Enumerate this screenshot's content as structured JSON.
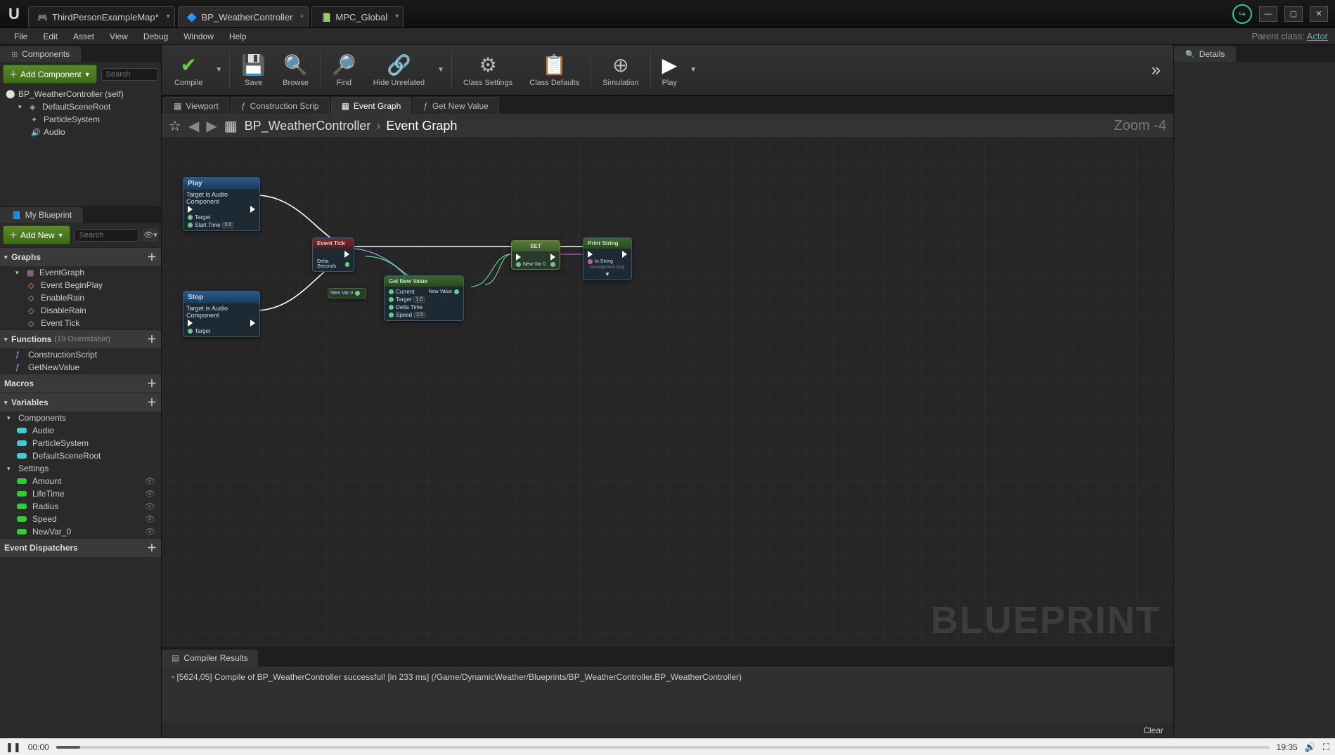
{
  "title_tabs": [
    {
      "label": "ThirdPersonExampleMap*",
      "icon": "🎮"
    },
    {
      "label": "BP_WeatherController",
      "icon": "🔷"
    },
    {
      "label": "MPC_Global",
      "icon": "📗"
    }
  ],
  "menubar": [
    "File",
    "Edit",
    "Asset",
    "View",
    "Debug",
    "Window",
    "Help"
  ],
  "parent_class_label": "Parent class:",
  "parent_class_value": "Actor",
  "components_panel": {
    "tab": "Components",
    "add_btn": "Add Component",
    "search_ph": "Search",
    "items": [
      {
        "label": "BP_WeatherController (self)",
        "indent": 0,
        "icon": "⚪"
      },
      {
        "label": "DefaultSceneRoot",
        "indent": 1,
        "icon": "◈"
      },
      {
        "label": "ParticleSystem",
        "indent": 2,
        "icon": "✦"
      },
      {
        "label": "Audio",
        "indent": 2,
        "icon": "🔊"
      }
    ]
  },
  "myblueprint": {
    "tab": "My Blueprint",
    "add_btn": "Add New",
    "search_ph": "Search",
    "sections": {
      "graphs": {
        "title": "Graphs",
        "items": [
          {
            "label": "EventGraph",
            "kind": "graph"
          },
          {
            "label": "Event BeginPlay",
            "kind": "event"
          },
          {
            "label": "EnableRain",
            "kind": "event"
          },
          {
            "label": "DisableRain",
            "kind": "event"
          },
          {
            "label": "Event Tick",
            "kind": "event"
          }
        ]
      },
      "functions": {
        "title": "Functions",
        "sub": "(19 Overridable)",
        "items": [
          {
            "label": "ConstructionScript"
          },
          {
            "label": "GetNewValue"
          }
        ]
      },
      "macros": {
        "title": "Macros"
      },
      "variables": {
        "title": "Variables",
        "groups": [
          {
            "name": "Components",
            "items": [
              {
                "label": "Audio",
                "color": "cyan"
              },
              {
                "label": "ParticleSystem",
                "color": "cyan"
              },
              {
                "label": "DefaultSceneRoot",
                "color": "cyan"
              }
            ]
          },
          {
            "name": "Settings",
            "items": [
              {
                "label": "Amount",
                "color": "green"
              },
              {
                "label": "LifeTime",
                "color": "green"
              },
              {
                "label": "Radius",
                "color": "green"
              },
              {
                "label": "Speed",
                "color": "green"
              }
            ]
          },
          {
            "name": "",
            "items": [
              {
                "label": "NewVar_0",
                "color": "green"
              }
            ]
          }
        ]
      },
      "dispatchers": {
        "title": "Event Dispatchers"
      }
    }
  },
  "toolbar": [
    {
      "label": "Compile",
      "icon": "✔",
      "caret": true
    },
    {
      "sep": true
    },
    {
      "label": "Save",
      "icon": "💾"
    },
    {
      "label": "Browse",
      "icon": "🔍"
    },
    {
      "sep": true
    },
    {
      "label": "Find",
      "icon": "🔎"
    },
    {
      "label": "Hide Unrelated",
      "icon": "🔗",
      "caret": true
    },
    {
      "sep": true
    },
    {
      "label": "Class Settings",
      "icon": "⚙"
    },
    {
      "label": "Class Defaults",
      "icon": "📋"
    },
    {
      "sep": true
    },
    {
      "label": "Simulation",
      "icon": "⊕"
    },
    {
      "sep": true
    },
    {
      "label": "Play",
      "icon": "▶",
      "caret": true
    }
  ],
  "graph_tabs": [
    {
      "label": "Viewport",
      "icon": "▦"
    },
    {
      "label": "Construction Scrip",
      "icon": "ƒ"
    },
    {
      "label": "Event Graph",
      "icon": "▦",
      "active": true
    },
    {
      "label": "Get New Value",
      "icon": "ƒ"
    }
  ],
  "graph_header": {
    "crumb1": "BP_WeatherController",
    "crumb2": "Event Graph",
    "zoom": "Zoom -4"
  },
  "nodes": {
    "play": {
      "title": "Play",
      "sub": "Target is Audio Component",
      "pins": {
        "target": "Target",
        "start": "Start Time",
        "start_val": "0.0"
      }
    },
    "stop": {
      "title": "Stop",
      "sub": "Target is Audio Component",
      "pins": {
        "target": "Target"
      }
    },
    "tick": {
      "title": "Event Tick",
      "pins": {
        "delta": "Delta Seconds"
      }
    },
    "newvar": {
      "label": "New Var 0"
    },
    "getnew": {
      "title": "Get New Value",
      "pins": {
        "current": "Current",
        "target": "Target",
        "target_val": "1.0",
        "dtime": "Delta Time",
        "speed": "Speed",
        "speed_val": "2.0",
        "out": "New Value"
      }
    },
    "set": {
      "title": "SET",
      "pins": {
        "var": "New Var 0"
      }
    },
    "print": {
      "title": "Print String",
      "pins": {
        "instr": "In String",
        "dev": "Development Only"
      }
    }
  },
  "compiler": {
    "tab": "Compiler Results",
    "msg": "[5624,05] Compile of BP_WeatherController successful! [in 233 ms] (/Game/DynamicWeather/Blueprints/BP_WeatherController.BP_WeatherController)",
    "clear": "Clear"
  },
  "details": {
    "tab": "Details"
  },
  "video": {
    "cur": "00:00",
    "dur": "19:35"
  }
}
